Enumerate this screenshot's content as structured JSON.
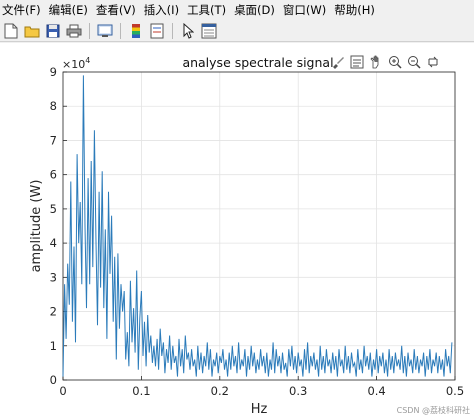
{
  "menu": {
    "items": [
      "文件(F)",
      "编辑(E)",
      "查看(V)",
      "插入(I)",
      "工具(T)",
      "桌面(D)",
      "窗口(W)",
      "帮助(H)"
    ]
  },
  "toolbar": {
    "buttons": [
      "new-file-icon",
      "open-folder-icon",
      "save-icon",
      "print-icon",
      "link-figure-icon",
      "insert-colorbar-icon",
      "pointer-icon",
      "property-inspector-icon"
    ]
  },
  "axes_toolbar": {
    "buttons": [
      "brush-icon",
      "data-tips-icon",
      "pan-icon",
      "zoom-in-icon",
      "zoom-out-icon",
      "restore-view-icon"
    ]
  },
  "watermark": "CSDN @荔枝科研社",
  "colors": {
    "line": "#2b7bba",
    "grid": "#e3e3e3",
    "axis": "#262626",
    "background": "#ffffff"
  },
  "chart_data": {
    "type": "line",
    "title": "analyse spectrale signal",
    "xlabel": "Hz",
    "ylabel": "amplitude (W)",
    "exponent_label": "×10",
    "exponent_power": "4",
    "xlim": [
      0,
      0.5
    ],
    "ylim": [
      0,
      90000
    ],
    "x_ticks": [
      0,
      0.1,
      0.2,
      0.3,
      0.4,
      0.5
    ],
    "x_tick_labels": [
      "0",
      "0.1",
      "0.2",
      "0.3",
      "0.4",
      "0.5"
    ],
    "y_ticks": [
      0,
      10000,
      20000,
      30000,
      40000,
      50000,
      60000,
      70000,
      80000,
      90000
    ],
    "y_tick_labels": [
      "0",
      "1",
      "2",
      "3",
      "4",
      "5",
      "6",
      "7",
      "8",
      "9"
    ],
    "grid": true,
    "x": [
      0,
      0.002,
      0.004,
      0.006,
      0.008,
      0.01,
      0.012,
      0.014,
      0.016,
      0.018,
      0.02,
      0.022,
      0.024,
      0.026,
      0.028,
      0.03,
      0.032,
      0.034,
      0.036,
      0.038,
      0.04,
      0.042,
      0.044,
      0.046,
      0.048,
      0.05,
      0.052,
      0.054,
      0.056,
      0.058,
      0.06,
      0.062,
      0.064,
      0.066,
      0.068,
      0.07,
      0.072,
      0.074,
      0.076,
      0.078,
      0.08,
      0.082,
      0.084,
      0.086,
      0.088,
      0.09,
      0.092,
      0.094,
      0.096,
      0.098,
      0.1,
      0.102,
      0.104,
      0.106,
      0.108,
      0.11,
      0.112,
      0.114,
      0.116,
      0.118,
      0.12,
      0.122,
      0.124,
      0.126,
      0.128,
      0.13,
      0.132,
      0.134,
      0.136,
      0.138,
      0.14,
      0.142,
      0.144,
      0.146,
      0.148,
      0.15,
      0.152,
      0.154,
      0.156,
      0.158,
      0.16,
      0.162,
      0.164,
      0.166,
      0.168,
      0.17,
      0.172,
      0.174,
      0.176,
      0.178,
      0.18,
      0.182,
      0.184,
      0.186,
      0.188,
      0.19,
      0.192,
      0.194,
      0.196,
      0.198,
      0.2,
      0.202,
      0.204,
      0.206,
      0.208,
      0.21,
      0.212,
      0.214,
      0.216,
      0.218,
      0.22,
      0.222,
      0.224,
      0.226,
      0.228,
      0.23,
      0.232,
      0.234,
      0.236,
      0.238,
      0.24,
      0.242,
      0.244,
      0.246,
      0.248,
      0.25,
      0.252,
      0.254,
      0.256,
      0.258,
      0.26,
      0.262,
      0.264,
      0.266,
      0.268,
      0.27,
      0.272,
      0.274,
      0.276,
      0.278,
      0.28,
      0.282,
      0.284,
      0.286,
      0.288,
      0.29,
      0.292,
      0.294,
      0.296,
      0.298,
      0.3,
      0.302,
      0.304,
      0.306,
      0.308,
      0.31,
      0.312,
      0.314,
      0.316,
      0.318,
      0.32,
      0.322,
      0.324,
      0.326,
      0.328,
      0.33,
      0.332,
      0.334,
      0.336,
      0.338,
      0.34,
      0.342,
      0.344,
      0.346,
      0.348,
      0.35,
      0.352,
      0.354,
      0.356,
      0.358,
      0.36,
      0.362,
      0.364,
      0.366,
      0.368,
      0.37,
      0.372,
      0.374,
      0.376,
      0.378,
      0.38,
      0.382,
      0.384,
      0.386,
      0.388,
      0.39,
      0.392,
      0.394,
      0.396,
      0.398,
      0.4,
      0.402,
      0.404,
      0.406,
      0.408,
      0.41,
      0.412,
      0.414,
      0.416,
      0.418,
      0.42,
      0.422,
      0.424,
      0.426,
      0.428,
      0.43,
      0.432,
      0.434,
      0.436,
      0.438,
      0.44,
      0.442,
      0.444,
      0.446,
      0.448,
      0.45,
      0.452,
      0.454,
      0.456,
      0.458,
      0.46,
      0.462,
      0.464,
      0.466,
      0.468,
      0.47,
      0.472,
      0.474,
      0.476,
      0.478,
      0.48,
      0.482,
      0.484,
      0.486,
      0.488,
      0.49,
      0.492,
      0.494,
      0.496,
      0.498,
      0.5
    ],
    "y": [
      1000,
      28000,
      12000,
      34000,
      22000,
      58000,
      17000,
      39000,
      11000,
      66000,
      40000,
      52000,
      28000,
      89000,
      45000,
      21000,
      59000,
      28000,
      64000,
      33000,
      73000,
      42000,
      16000,
      55000,
      27000,
      61000,
      21000,
      44000,
      12000,
      55000,
      31000,
      48000,
      17000,
      36000,
      6000,
      37000,
      15000,
      28000,
      20000,
      26000,
      6000,
      14000,
      4000,
      29000,
      11000,
      21000,
      8000,
      32000,
      3000,
      18000,
      26000,
      7000,
      17000,
      4000,
      19000,
      8000,
      13000,
      5000,
      10000,
      4000,
      12000,
      3000,
      15000,
      7000,
      11000,
      2000,
      9000,
      5000,
      13000,
      3000,
      10000,
      5000,
      7000,
      1000,
      12000,
      4000,
      9000,
      2000,
      13000,
      6000,
      8000,
      3000,
      9000,
      4000,
      6000,
      1000,
      10000,
      3000,
      8000,
      2000,
      7000,
      4000,
      11000,
      3000,
      9000,
      1000,
      6000,
      4000,
      8000,
      2000,
      7000,
      5000,
      9000,
      3000,
      6000,
      1000,
      8000,
      3000,
      10000,
      4000,
      7000,
      2000,
      11000,
      3000,
      6000,
      4000,
      9000,
      1000,
      7000,
      3000,
      10000,
      4000,
      8000,
      2000,
      6000,
      3000,
      9000,
      4000,
      7000,
      2000,
      8000,
      1000,
      6000,
      3000,
      11000,
      2000,
      9000,
      4000,
      7000,
      2000,
      8000,
      3000,
      5000,
      1000,
      9000,
      4000,
      10000,
      3000,
      7000,
      2000,
      8000,
      4000,
      6000,
      1000,
      9000,
      3000,
      11000,
      2000,
      7000,
      4000,
      8000,
      3000,
      6000,
      1000,
      10000,
      3000,
      7000,
      2000,
      9000,
      4000,
      6000,
      2000,
      8000,
      3000,
      7000,
      1000,
      9000,
      4000,
      6000,
      2000,
      10000,
      3000,
      7000,
      2000,
      8000,
      4000,
      5000,
      1000,
      9000,
      3000,
      6000,
      2000,
      10000,
      4000,
      7000,
      3000,
      8000,
      1000,
      6000,
      3000,
      9000,
      2000,
      7000,
      4000,
      8000,
      2000,
      6000,
      1000,
      9000,
      3000,
      7000,
      2000,
      8000,
      4000,
      6000,
      3000,
      10000,
      2000,
      7000,
      1000,
      8000,
      4000,
      6000,
      2000,
      9000,
      3000,
      7000,
      2000,
      6000,
      4000,
      8000,
      1000,
      7000,
      3000,
      9000,
      2000,
      6000,
      4000,
      8000,
      2000,
      7000,
      3000,
      6000,
      1000,
      9000,
      4000,
      7000,
      2000,
      11000
    ]
  }
}
